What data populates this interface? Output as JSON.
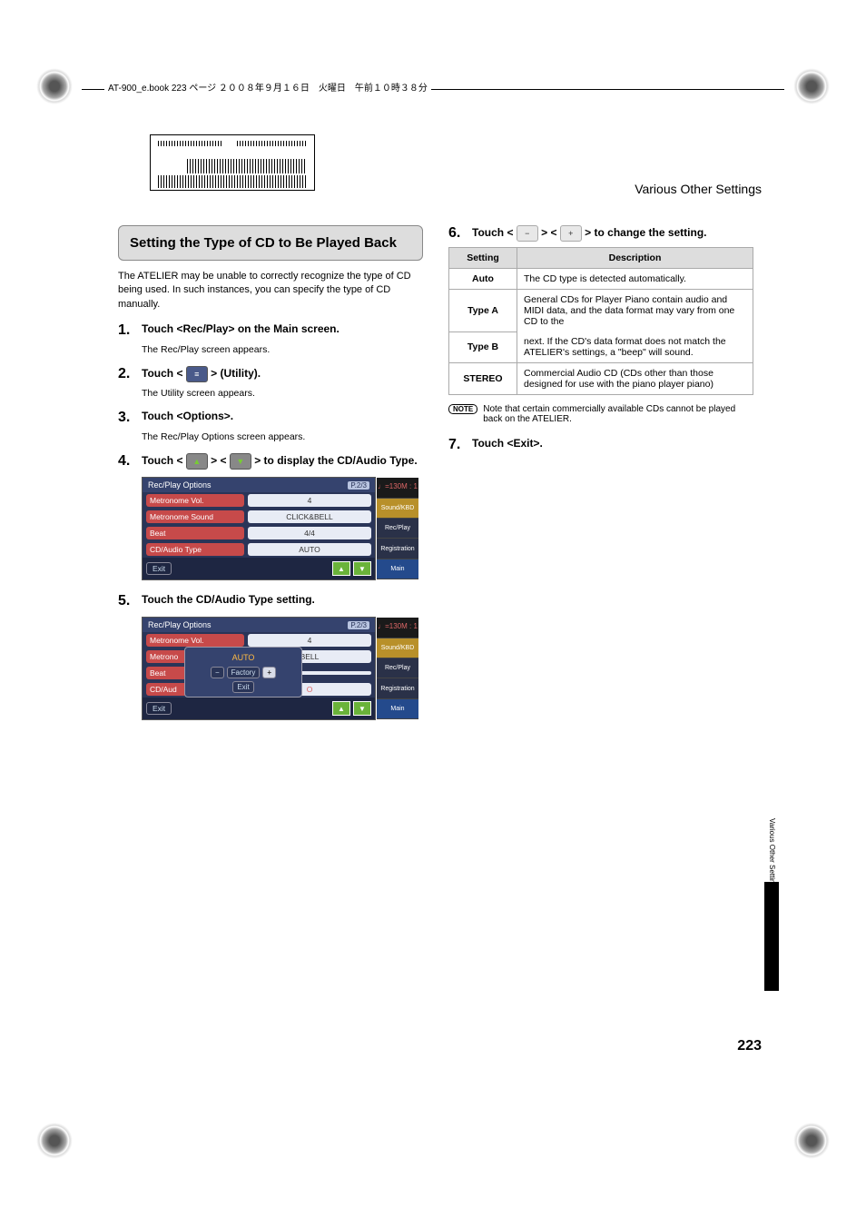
{
  "print_header": "AT-900_e.book  223 ページ  ２００８年９月１６日　火曜日　午前１０時３８分",
  "section_header": "Various Other Settings",
  "heading": "Setting the Type of CD to Be Played Back",
  "intro": "The ATELIER may be unable to correctly recognize the type of CD being used. In such instances, you can specify the type of CD manually.",
  "steps": {
    "s1": {
      "num": "1.",
      "text": "Touch <Rec/Play> on the Main screen.",
      "sub": "The Rec/Play screen appears."
    },
    "s2": {
      "num": "2.",
      "pre": "Touch < ",
      "post": " > (Utility).",
      "sub": "The Utility screen appears."
    },
    "s3": {
      "num": "3.",
      "text": "Touch <Options>.",
      "sub": "The Rec/Play Options screen appears."
    },
    "s4": {
      "num": "4.",
      "pre": "Touch <",
      "mid": "> <",
      "post": "> to display the CD/Audio Type."
    },
    "s5": {
      "num": "5.",
      "text": "Touch the CD/Audio Type setting."
    },
    "s6": {
      "num": "6.",
      "pre": "Touch < ",
      "mid": " > < ",
      "post": " > to change the setting."
    },
    "s7": {
      "num": "7.",
      "text": "Touch <Exit>."
    }
  },
  "screenshot1": {
    "title": "Rec/Play Options",
    "page": "P.2/3",
    "tempo": "♩=130",
    "m": "M :     1",
    "rows": [
      {
        "lbl": "Metronome Vol.",
        "val": "4"
      },
      {
        "lbl": "Metronome Sound",
        "val": "CLICK&BELL"
      },
      {
        "lbl": "Beat",
        "val": "4/4"
      },
      {
        "lbl": "CD/Audio Type",
        "val": "AUTO"
      }
    ],
    "exit": "Exit",
    "side": [
      "Sound/KBD",
      "Rec/Play",
      "Registration",
      "Main"
    ]
  },
  "screenshot2": {
    "title": "Rec/Play Options",
    "page": "P.2/3",
    "tempo": "♩=130",
    "m": "M :     1",
    "rows": [
      {
        "lbl": "Metronome Vol.",
        "val": "4"
      },
      {
        "lbl": "Metrono",
        "val": "BELL"
      },
      {
        "lbl": "Beat",
        "val": ""
      },
      {
        "lbl": "CD/Aud",
        "val": "O"
      }
    ],
    "popup": {
      "value": "AUTO",
      "minus": "−",
      "factory": "Factory",
      "plus": "+",
      "exit": "Exit"
    },
    "exit": "Exit",
    "side": [
      "Sound/KBD",
      "Rec/Play",
      "Registration",
      "Main"
    ]
  },
  "table": {
    "head": {
      "c1": "Setting",
      "c2": "Description"
    },
    "rows": [
      {
        "c1": "Auto",
        "c2": "The CD type is detected automatically."
      },
      {
        "c1": "Type A",
        "c2": "General CDs for Player Piano contain audio and MIDI data, and the data format may vary from one CD to the"
      },
      {
        "c1": "Type B",
        "c2": "next. If the CD's data format does not match the ATELIER's settings, a \"beep\" will sound."
      },
      {
        "c1": "STEREO",
        "c2": "Commercial Audio CD (CDs other than those designed for use with the piano player piano)"
      }
    ]
  },
  "note_label": "NOTE",
  "note_text": "Note that certain commercially available CDs cannot be played back on the ATELIER.",
  "side_tab_text": "Various Other Settings",
  "page_number": "223"
}
